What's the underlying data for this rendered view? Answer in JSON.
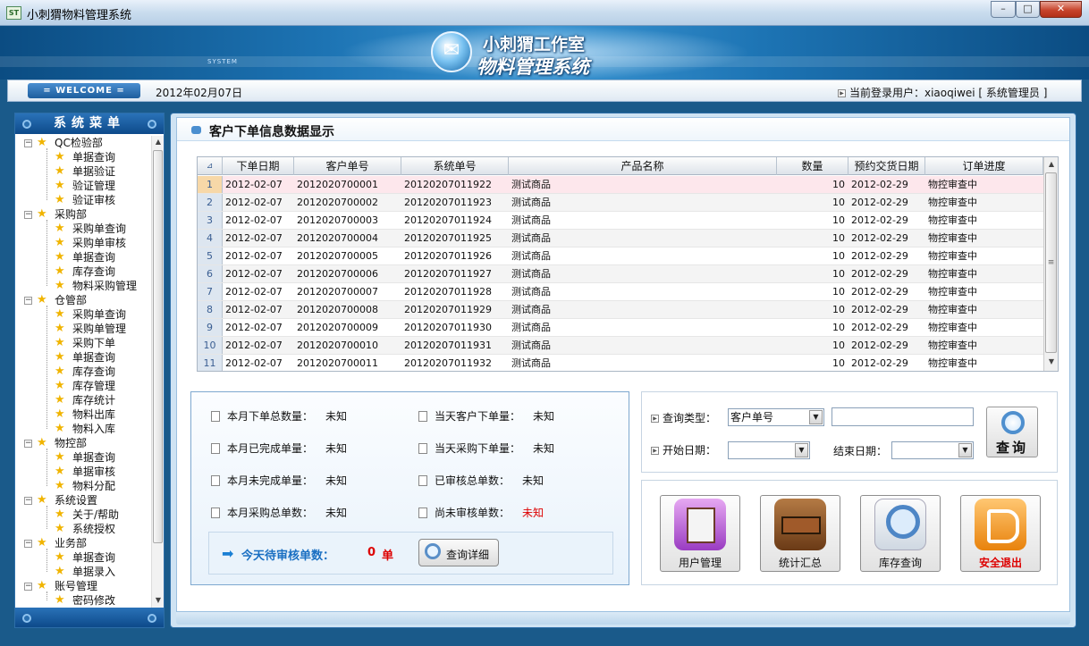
{
  "window": {
    "logo_text": "ST",
    "title": "小刺猬物料管理系统",
    "min_glyph": "–",
    "max_glyph": "□",
    "close_glyph": "✕"
  },
  "banner": {
    "system_tag": "SYSTEM",
    "studio": "小刺猬工作室",
    "system_name": "物料管理系统"
  },
  "infobar": {
    "welcome": "= WELCOME =",
    "date": "2012年02月07日",
    "user_label": "当前登录用户：xiaoqiwei  [ 系统管理员 ]"
  },
  "sidebar": {
    "title": "系统菜单",
    "tree": [
      {
        "label": "QC检验部",
        "children": [
          "单据查询",
          "单据验证",
          "验证管理",
          "验证审核"
        ]
      },
      {
        "label": "采购部",
        "children": [
          "采购单查询",
          "采购单审核",
          "单据查询",
          "库存查询",
          "物料采购管理"
        ]
      },
      {
        "label": "仓管部",
        "children": [
          "采购单查询",
          "采购单管理",
          "采购下单",
          "单据查询",
          "库存查询",
          "库存管理",
          "库存统计",
          "物料出库",
          "物料入库"
        ]
      },
      {
        "label": "物控部",
        "children": [
          "单据查询",
          "单据审核",
          "物料分配"
        ]
      },
      {
        "label": "系统设置",
        "children": [
          "关于/帮助",
          "系统授权"
        ]
      },
      {
        "label": "业务部",
        "children": [
          "单据查询",
          "单据录入"
        ]
      },
      {
        "label": "账号管理",
        "children": [
          "密码修改"
        ]
      }
    ]
  },
  "panel": {
    "title": "客户下单信息数据显示"
  },
  "grid": {
    "columns": [
      "下单日期",
      "客户单号",
      "系统单号",
      "产品名称",
      "数量",
      "预约交货日期",
      "订单进度"
    ],
    "rows": [
      [
        "1",
        "2012-02-07",
        "2012020700001",
        "20120207011922",
        "测试商品",
        "10",
        "2012-02-29",
        "物控审查中"
      ],
      [
        "2",
        "2012-02-07",
        "2012020700002",
        "20120207011923",
        "测试商品",
        "10",
        "2012-02-29",
        "物控审查中"
      ],
      [
        "3",
        "2012-02-07",
        "2012020700003",
        "20120207011924",
        "测试商品",
        "10",
        "2012-02-29",
        "物控审查中"
      ],
      [
        "4",
        "2012-02-07",
        "2012020700004",
        "20120207011925",
        "测试商品",
        "10",
        "2012-02-29",
        "物控审查中"
      ],
      [
        "5",
        "2012-02-07",
        "2012020700005",
        "20120207011926",
        "测试商品",
        "10",
        "2012-02-29",
        "物控审查中"
      ],
      [
        "6",
        "2012-02-07",
        "2012020700006",
        "20120207011927",
        "测试商品",
        "10",
        "2012-02-29",
        "物控审查中"
      ],
      [
        "7",
        "2012-02-07",
        "2012020700007",
        "20120207011928",
        "测试商品",
        "10",
        "2012-02-29",
        "物控审查中"
      ],
      [
        "8",
        "2012-02-07",
        "2012020700008",
        "20120207011929",
        "测试商品",
        "10",
        "2012-02-29",
        "物控审查中"
      ],
      [
        "9",
        "2012-02-07",
        "2012020700009",
        "20120207011930",
        "测试商品",
        "10",
        "2012-02-29",
        "物控审查中"
      ],
      [
        "10",
        "2012-02-07",
        "2012020700010",
        "20120207011931",
        "测试商品",
        "10",
        "2012-02-29",
        "物控审查中"
      ],
      [
        "11",
        "2012-02-07",
        "2012020700011",
        "20120207011932",
        "测试商品",
        "10",
        "2012-02-29",
        "物控审查中"
      ]
    ]
  },
  "stats": {
    "items": [
      {
        "label": "本月下单总数量：",
        "value": "未知"
      },
      {
        "label": "当天客户下单量：",
        "value": "未知"
      },
      {
        "label": "本月已完成单量：",
        "value": "未知"
      },
      {
        "label": "当天采购下单量：",
        "value": "未知"
      },
      {
        "label": "本月未完成单量：",
        "value": "未知"
      },
      {
        "label": "已审核总单数：",
        "value": "未知"
      },
      {
        "label": "本月采购总单数：",
        "value": "未知"
      },
      {
        "label": "尚未审核单数：",
        "value": "未知"
      }
    ],
    "pending_label": "今天待审核单数：",
    "pending_count": "0",
    "pending_unit": "单",
    "detail_button": "查询详细"
  },
  "query": {
    "type_label": "查询类型：",
    "type_value": "客户单号",
    "start_label": "开始日期：",
    "end_label": "结束日期：",
    "button": "查询"
  },
  "actions": {
    "user": "用户管理",
    "stats": "统计汇总",
    "stock": "库存查询",
    "exit": "安全退出"
  },
  "colors": {
    "accent": "#1d5e9e",
    "danger": "#dd0000",
    "selected_row": "#fde7ec"
  }
}
